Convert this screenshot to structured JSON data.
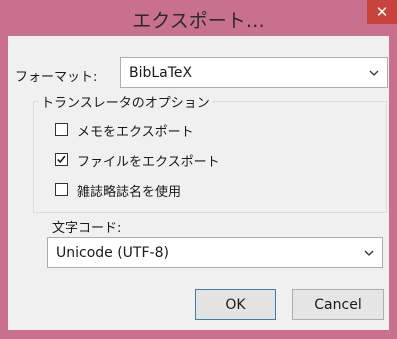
{
  "window": {
    "title": "エクスポート…"
  },
  "format": {
    "label": "フォーマット:",
    "value": "BibLaTeX"
  },
  "options": {
    "group_label": "トランスレータのオプション",
    "items": [
      {
        "label": "メモをエクスポート",
        "checked": false
      },
      {
        "label": "ファイルをエクスポート",
        "checked": true
      },
      {
        "label": "雑誌略誌名を使用",
        "checked": false
      }
    ]
  },
  "charset": {
    "label": "文字コード:",
    "value": "Unicode (UTF-8)"
  },
  "buttons": {
    "ok": "OK",
    "cancel": "Cancel"
  },
  "colors": {
    "titlebar": "#c8708e",
    "close": "#c7433c",
    "client": "#f0f0f0"
  }
}
